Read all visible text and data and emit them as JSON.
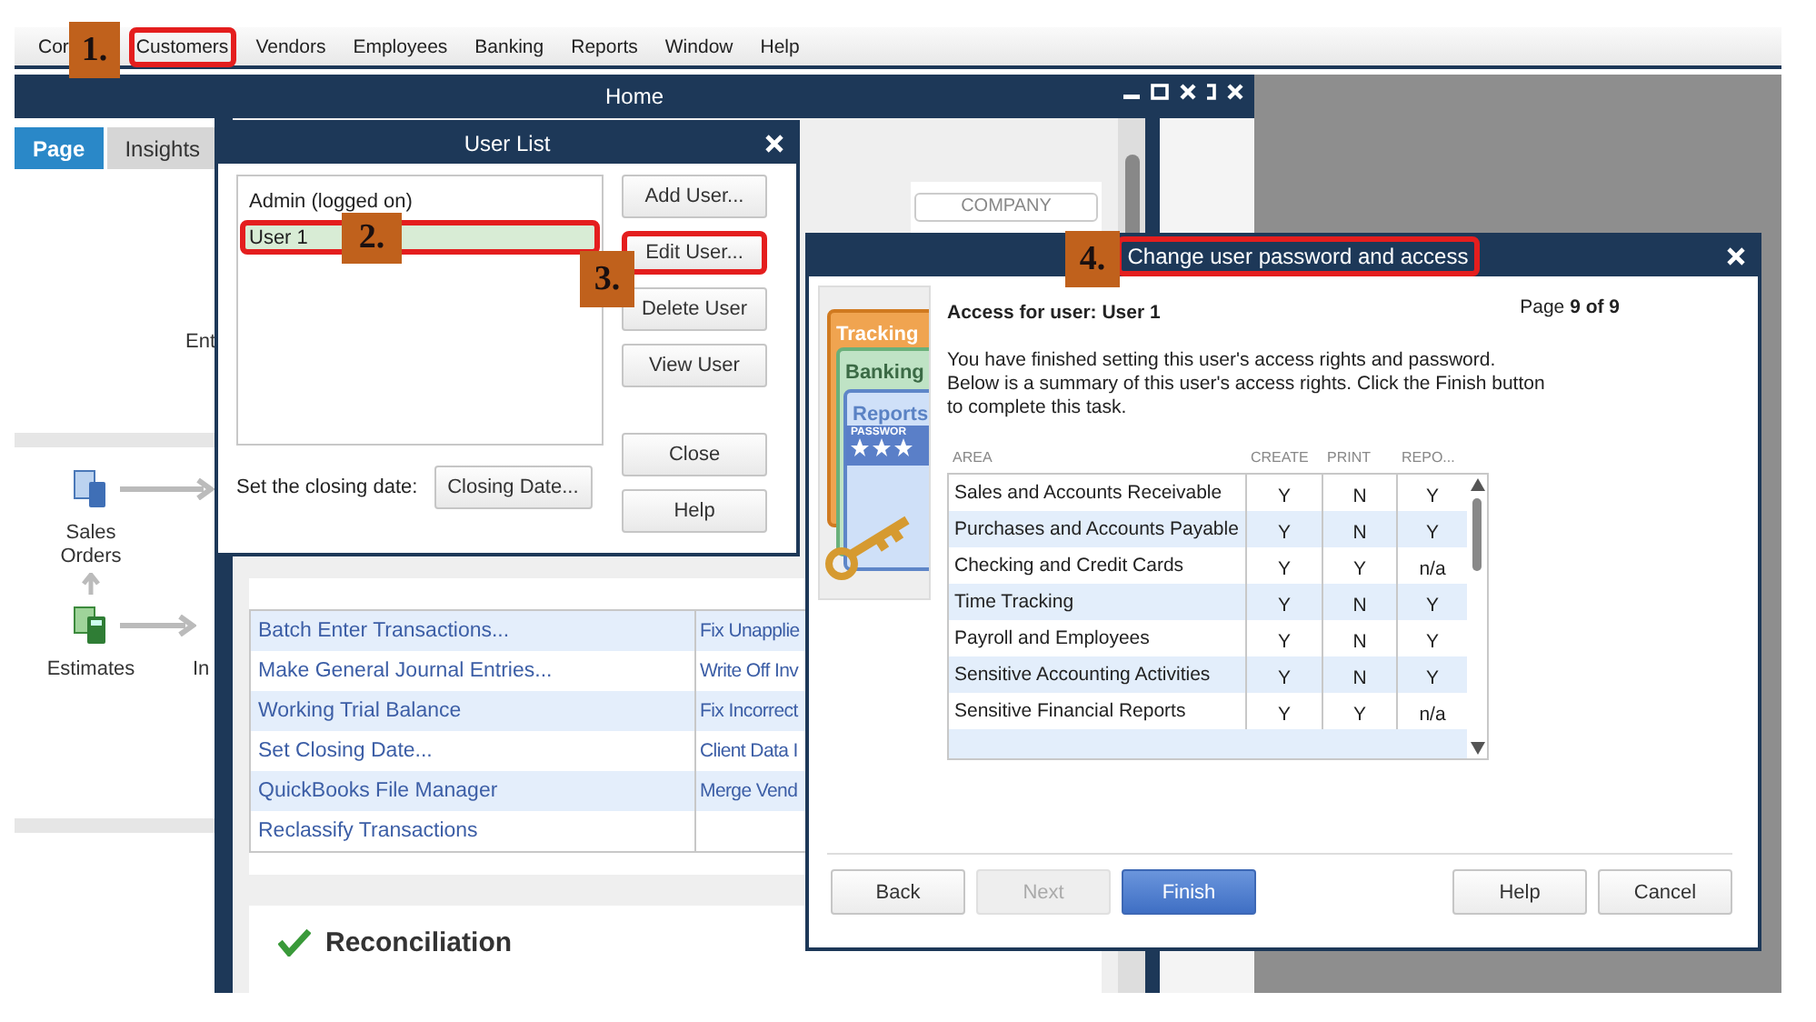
{
  "menu_bar": {
    "items": [
      {
        "label": "Cor"
      },
      {
        "label": "Customers",
        "highlighted": true
      },
      {
        "label": "Vendors"
      },
      {
        "label": "Employees"
      },
      {
        "label": "Banking"
      },
      {
        "label": "Reports"
      },
      {
        "label": "Window"
      },
      {
        "label": "Help"
      }
    ]
  },
  "home_window": {
    "title": "Home",
    "tabs": [
      {
        "label": "Page",
        "selected": true
      },
      {
        "label": "Insights",
        "selected": false
      }
    ],
    "workflow": {
      "partial_top": "Ent",
      "partial_bottom": "In",
      "nodes": [
        {
          "label": "Sales Orders",
          "kind": "sales-orders"
        },
        {
          "label": "Estimates",
          "kind": "estimates"
        }
      ]
    },
    "company_button": "COMPANY",
    "tasks": [
      {
        "left": "Batch Enter Transactions...",
        "right": "Fix Unapplie"
      },
      {
        "left": "Make General Journal Entries...",
        "right": "Write Off Inv"
      },
      {
        "left": "Working Trial Balance",
        "right": "Fix Incorrect"
      },
      {
        "left": "Set Closing Date...",
        "right": "Client Data I"
      },
      {
        "left": "QuickBooks File Manager",
        "right": "Merge Vend"
      },
      {
        "left": "Reclassify Transactions"
      }
    ],
    "reconciliation": {
      "title": "Reconciliation"
    }
  },
  "user_list": {
    "title": "User List",
    "users": [
      {
        "name": "Admin (logged on)",
        "selected": false,
        "highlighted": false
      },
      {
        "name": "User 1",
        "selected": true,
        "highlighted": true
      }
    ],
    "buttons": [
      {
        "label": "Add User...",
        "highlighted": false
      },
      {
        "label": "Edit User...",
        "highlighted": true
      },
      {
        "label": "Delete User",
        "highlighted": false
      },
      {
        "label": "View User",
        "highlighted": false
      }
    ],
    "bottom_buttons": [
      {
        "label": "Close"
      },
      {
        "label": "Help"
      }
    ],
    "closing_label": "Set the closing date:",
    "closing_button": "Closing Date..."
  },
  "change_dialog": {
    "title": "Change user password and access",
    "title_highlighted": true,
    "illustration": {
      "tracking": "Tracking",
      "banking": "Banking",
      "reports": "Reports",
      "password": "PASSWOR"
    },
    "heading": "Access for user: User 1",
    "page": "Page **9 of 9**",
    "message": "You have finished setting this user's access rights and password.\nBelow is a summary of this user's access rights.  Click the Finish button\nto complete this task.",
    "columns": [
      "AREA",
      "CREATE",
      "PRINT",
      "REPO..."
    ],
    "rows": [
      {
        "area": "Sales and Accounts Receivable",
        "create": "Y",
        "print": "N",
        "reports": "Y"
      },
      {
        "area": "Purchases and Accounts Payable",
        "create": "Y",
        "print": "N",
        "reports": "Y"
      },
      {
        "area": "Checking and Credit Cards",
        "create": "Y",
        "print": "Y",
        "reports": "n/a"
      },
      {
        "area": "Time Tracking",
        "create": "Y",
        "print": "N",
        "reports": "Y"
      },
      {
        "area": "Payroll and Employees",
        "create": "Y",
        "print": "N",
        "reports": "Y"
      },
      {
        "area": "Sensitive Accounting Activities",
        "create": "Y",
        "print": "N",
        "reports": "Y"
      },
      {
        "area": "Sensitive Financial Reports",
        "create": "Y",
        "print": "Y",
        "reports": "n/a"
      }
    ],
    "nav_buttons": [
      {
        "label": "Back",
        "kind": "default",
        "disabled": false
      },
      {
        "label": "Next",
        "kind": "default",
        "disabled": true
      },
      {
        "label": "Finish",
        "kind": "primary",
        "disabled": false
      }
    ],
    "action_buttons": [
      {
        "label": "Help"
      },
      {
        "label": "Cancel"
      }
    ]
  },
  "callouts": [
    {
      "number": "1."
    },
    {
      "number": "2."
    },
    {
      "number": "3."
    },
    {
      "number": "4."
    }
  ]
}
